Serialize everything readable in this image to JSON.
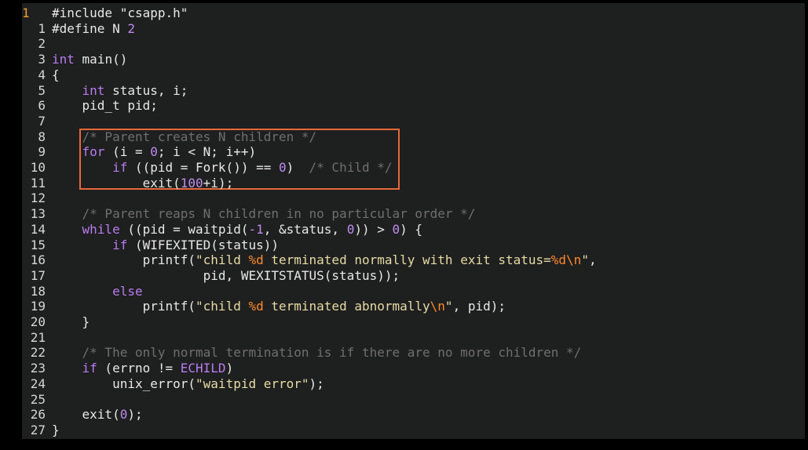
{
  "editor": {
    "current_line_number": "1",
    "highlight_color": "#e8683a",
    "lines": [
      {
        "num": "",
        "segments": [
          {
            "t": "#include \"csapp.h\"",
            "c": "pre"
          }
        ]
      },
      {
        "num": "1",
        "segments": [
          {
            "t": "#define N ",
            "c": "pre"
          },
          {
            "t": "2",
            "c": "num"
          }
        ]
      },
      {
        "num": "2",
        "segments": []
      },
      {
        "num": "3",
        "segments": [
          {
            "t": "int",
            "c": "kw"
          },
          {
            "t": " main()",
            "c": ""
          }
        ]
      },
      {
        "num": "4",
        "segments": [
          {
            "t": "{",
            "c": ""
          }
        ]
      },
      {
        "num": "5",
        "segments": [
          {
            "t": "    ",
            "c": ""
          },
          {
            "t": "int",
            "c": "kw"
          },
          {
            "t": " status, i;",
            "c": ""
          }
        ]
      },
      {
        "num": "6",
        "segments": [
          {
            "t": "    pid_t pid;",
            "c": ""
          }
        ]
      },
      {
        "num": "7",
        "segments": []
      },
      {
        "num": "8",
        "segments": [
          {
            "t": "    ",
            "c": ""
          },
          {
            "t": "/* Parent creates N children */",
            "c": "cmt"
          }
        ]
      },
      {
        "num": "9",
        "segments": [
          {
            "t": "    ",
            "c": ""
          },
          {
            "t": "for",
            "c": "kw"
          },
          {
            "t": " (i = ",
            "c": ""
          },
          {
            "t": "0",
            "c": "num"
          },
          {
            "t": "; i < N; i++)",
            "c": ""
          }
        ]
      },
      {
        "num": "10",
        "segments": [
          {
            "t": "        ",
            "c": ""
          },
          {
            "t": "if",
            "c": "kw"
          },
          {
            "t": " ((pid = Fork()) == ",
            "c": ""
          },
          {
            "t": "0",
            "c": "num"
          },
          {
            "t": ")  ",
            "c": ""
          },
          {
            "t": "/* Child */",
            "c": "cmt"
          }
        ]
      },
      {
        "num": "11",
        "segments": [
          {
            "t": "            exit(",
            "c": ""
          },
          {
            "t": "100",
            "c": "num"
          },
          {
            "t": "+i);",
            "c": ""
          }
        ]
      },
      {
        "num": "12",
        "segments": []
      },
      {
        "num": "13",
        "segments": [
          {
            "t": "    ",
            "c": ""
          },
          {
            "t": "/* Parent reaps N children in no particular order */",
            "c": "cmt"
          }
        ]
      },
      {
        "num": "14",
        "segments": [
          {
            "t": "    ",
            "c": ""
          },
          {
            "t": "while",
            "c": "kw"
          },
          {
            "t": " ((pid = waitpid(",
            "c": ""
          },
          {
            "t": "-1",
            "c": "num"
          },
          {
            "t": ", &status, ",
            "c": ""
          },
          {
            "t": "0",
            "c": "num"
          },
          {
            "t": ")) > ",
            "c": ""
          },
          {
            "t": "0",
            "c": "num"
          },
          {
            "t": ") {",
            "c": ""
          }
        ]
      },
      {
        "num": "15",
        "segments": [
          {
            "t": "        ",
            "c": ""
          },
          {
            "t": "if",
            "c": "kw"
          },
          {
            "t": " (WIFEXITED(status))",
            "c": ""
          }
        ]
      },
      {
        "num": "16",
        "segments": [
          {
            "t": "            printf(",
            "c": ""
          },
          {
            "t": "\"child ",
            "c": "str"
          },
          {
            "t": "%d",
            "c": "fmt"
          },
          {
            "t": " terminated normally with exit status=",
            "c": "str"
          },
          {
            "t": "%d\\n",
            "c": "fmt"
          },
          {
            "t": "\"",
            "c": "str"
          },
          {
            "t": ",",
            "c": ""
          }
        ]
      },
      {
        "num": "17",
        "segments": [
          {
            "t": "                    pid, WEXITSTATUS(status));",
            "c": ""
          }
        ]
      },
      {
        "num": "18",
        "segments": [
          {
            "t": "        ",
            "c": ""
          },
          {
            "t": "else",
            "c": "kw"
          }
        ]
      },
      {
        "num": "19",
        "segments": [
          {
            "t": "            printf(",
            "c": ""
          },
          {
            "t": "\"child ",
            "c": "str"
          },
          {
            "t": "%d",
            "c": "fmt"
          },
          {
            "t": " terminated abnormally",
            "c": "str"
          },
          {
            "t": "\\n",
            "c": "fmt"
          },
          {
            "t": "\"",
            "c": "str"
          },
          {
            "t": ", pid);",
            "c": ""
          }
        ]
      },
      {
        "num": "20",
        "segments": [
          {
            "t": "    }",
            "c": ""
          }
        ]
      },
      {
        "num": "21",
        "segments": []
      },
      {
        "num": "22",
        "segments": [
          {
            "t": "    ",
            "c": ""
          },
          {
            "t": "/* The only normal termination is if there are no more children */",
            "c": "cmt"
          }
        ]
      },
      {
        "num": "23",
        "segments": [
          {
            "t": "    ",
            "c": ""
          },
          {
            "t": "if",
            "c": "kw"
          },
          {
            "t": " (errno != ",
            "c": ""
          },
          {
            "t": "ECHILD",
            "c": "kw"
          },
          {
            "t": ")",
            "c": ""
          }
        ]
      },
      {
        "num": "24",
        "segments": [
          {
            "t": "        unix_error(",
            "c": ""
          },
          {
            "t": "\"waitpid error\"",
            "c": "str"
          },
          {
            "t": ");",
            "c": ""
          }
        ]
      },
      {
        "num": "25",
        "segments": []
      },
      {
        "num": "26",
        "segments": [
          {
            "t": "    exit(",
            "c": ""
          },
          {
            "t": "0",
            "c": "num"
          },
          {
            "t": ");",
            "c": ""
          }
        ]
      },
      {
        "num": "27",
        "segments": [
          {
            "t": "}",
            "c": ""
          }
        ]
      }
    ]
  }
}
